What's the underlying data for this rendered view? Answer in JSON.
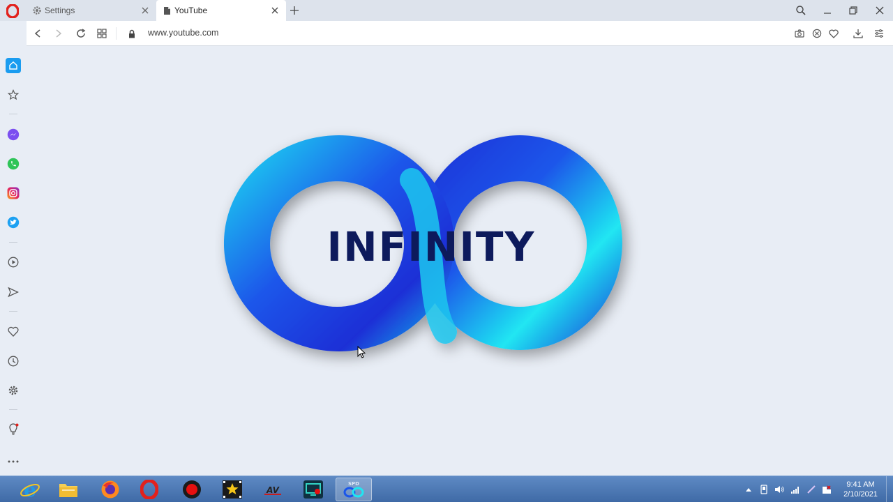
{
  "browser": {
    "tabs": [
      {
        "label": "Settings",
        "icon": "gear-icon",
        "active": false
      },
      {
        "label": "YouTube",
        "icon": "page-icon",
        "active": true
      }
    ],
    "url": "www.youtube.com",
    "accent_color": "#e2211c"
  },
  "sidebar": {
    "items": [
      "home-icon",
      "bookmarks-icon",
      "messenger-icon",
      "whatsapp-icon",
      "instagram-icon",
      "twitter-icon",
      "player-icon",
      "flow-icon",
      "heart-icon",
      "history-icon",
      "settings-icon",
      "tips-icon",
      "more-icon"
    ]
  },
  "content": {
    "logo_text": "INFINITY",
    "logo_colors": {
      "primary": "#1a3fe0",
      "secondary": "#20e0f0",
      "text": "#0d1a5c"
    }
  },
  "taskbar": {
    "apps": [
      "internet-explorer-icon",
      "file-explorer-icon",
      "firefox-icon",
      "opera-icon",
      "recorder-icon",
      "movie-maker-icon",
      "av-icon",
      "screen-recorder-icon",
      "spd-infinity-icon"
    ],
    "spd_label": "SPD",
    "time": "9:41 AM",
    "date": "2/10/2021"
  }
}
